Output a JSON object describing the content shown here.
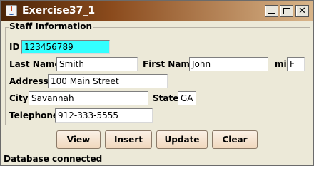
{
  "window": {
    "title": "Exercise37_1"
  },
  "group": {
    "title": "Staff Information"
  },
  "form": {
    "id_label": "ID",
    "id_value": "123456789",
    "last_name_label": "Last Name",
    "last_name_value": "Smith",
    "first_name_label": "First Name",
    "first_name_value": "John",
    "mi_label": "mi",
    "mi_value": "F",
    "address_label": "Address",
    "address_value": "100 Main Street",
    "city_label": "City",
    "city_value": "Savannah",
    "state_label": "State",
    "state_value": "GA",
    "telephone_label": "Telephone",
    "telephone_value": "912-333-5555"
  },
  "buttons": {
    "view": "View",
    "insert": "Insert",
    "update": "Update",
    "clear": "Clear"
  },
  "status": {
    "text": "Database connected"
  },
  "colors": {
    "id_field_bg": "#33ffff",
    "title_bar": "#6b3512",
    "button_face": "#f3dfc9"
  },
  "icons": {
    "app": "java-cup-icon",
    "minimize": "minimize-icon",
    "maximize": "maximize-icon",
    "close": "close-icon"
  }
}
